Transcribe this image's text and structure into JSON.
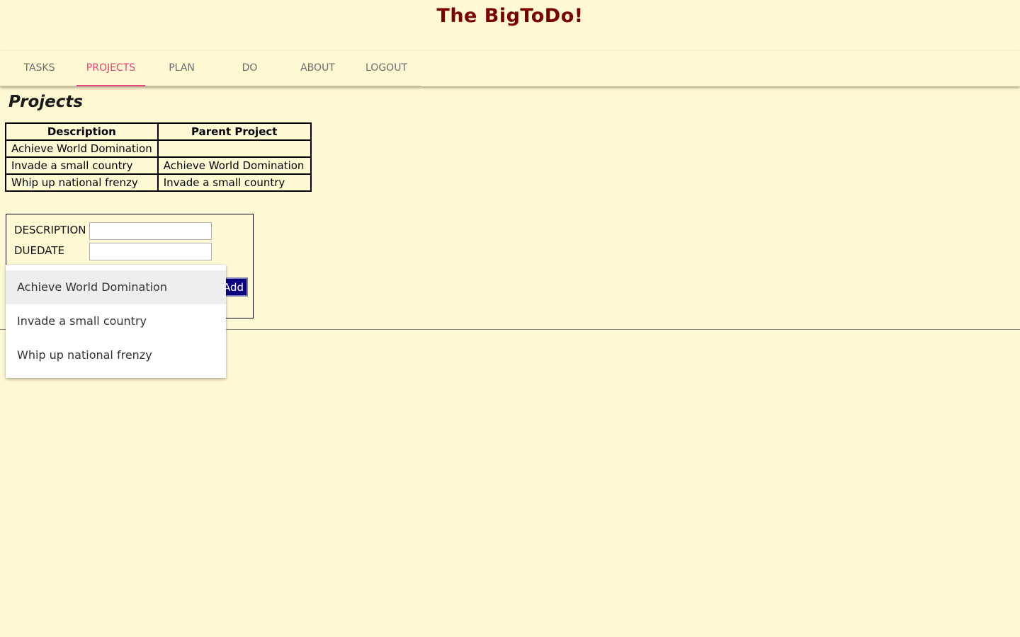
{
  "app": {
    "title": "The BigToDo!"
  },
  "nav": {
    "tabs": [
      {
        "label": "TASKS"
      },
      {
        "label": "PROJECTS",
        "active": true
      },
      {
        "label": "PLAN"
      },
      {
        "label": "DO"
      },
      {
        "label": "ABOUT"
      },
      {
        "label": "LOGOUT"
      }
    ]
  },
  "projects": {
    "heading": "Projects",
    "columns": [
      "Description",
      "Parent Project"
    ],
    "rows": [
      [
        "Achieve World Domination",
        ""
      ],
      [
        "Invade a small country",
        "Achieve World Domination"
      ],
      [
        "Whip up national frenzy",
        "Invade a small country"
      ]
    ]
  },
  "form": {
    "description_label": "DESCRIPTION",
    "description_value": "",
    "duedate_label": "DUEDATE",
    "duedate_value": "",
    "add_label": "Add"
  },
  "dropdown": {
    "options": [
      {
        "label": "Achieve World Domination",
        "highlighted": true
      },
      {
        "label": "Invade a small country"
      },
      {
        "label": "Whip up national frenzy"
      }
    ]
  },
  "colors": {
    "background": "#fff9d3",
    "title": "#7a0000",
    "active_tab": "#e8447a",
    "tab_text": "#6c6c6c",
    "add_button": "#0a0080"
  }
}
